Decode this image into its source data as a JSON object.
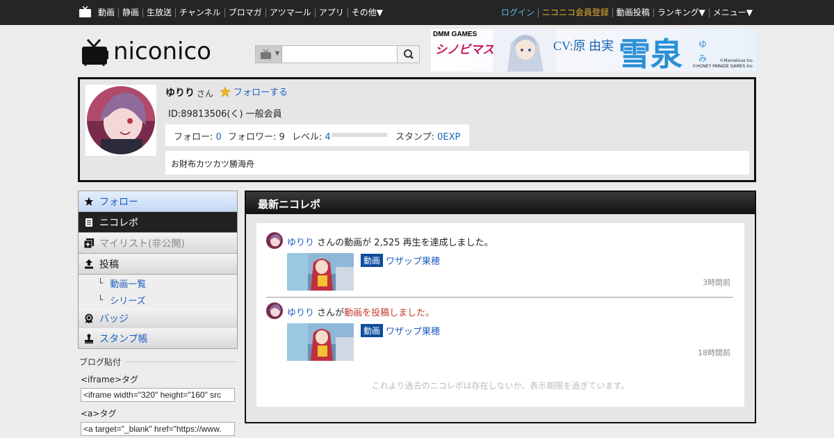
{
  "topbar": {
    "left_items": [
      "動画",
      "静画",
      "生放送",
      "チャンネル",
      "ブロマガ",
      "アツマール",
      "アプリ",
      "その他▼"
    ],
    "right_items": [
      {
        "label": "ログイン",
        "kind": "login"
      },
      {
        "label": "ニコニコ会員登録",
        "kind": "premium"
      },
      {
        "label": "動画投稿",
        "kind": "normal"
      },
      {
        "label": "ランキング▼",
        "kind": "normal"
      },
      {
        "label": "メニュー▼",
        "kind": "normal"
      }
    ]
  },
  "header": {
    "logo_text": "niconico",
    "search": {
      "value": "",
      "placeholder": ""
    }
  },
  "banner": {
    "brand": "DMM GAMES",
    "game": "シノビマスター",
    "cv": "CV:原 由実",
    "name": "雪泉",
    "reading": "ゆみ",
    "copyright1": "©Marvelous Inc.",
    "copyright2": "©HONEY PARADE GAMES Inc."
  },
  "profile": {
    "name": "ゆりり",
    "suffix": "さん",
    "follow_label": "フォローする",
    "id_line": "ID:89813506(く) 一般会員",
    "stats": {
      "follow_label": "フォロー:",
      "follow_value": "0",
      "follower_label": "フォロワー:",
      "follower_value": "9",
      "level_label": "レベル:",
      "level_value": "4",
      "level_progress": 0,
      "stamp_label": "スタンプ:",
      "stamp_value": "0EXP"
    },
    "description": "お財布カツカツ勝海舟"
  },
  "sidebar": {
    "items": [
      {
        "label": "フォロー",
        "icon": "star-icon"
      },
      {
        "label": "ニコレポ",
        "icon": "document-icon"
      },
      {
        "label": "マイリスト(非公開)",
        "icon": "mylist-add-icon"
      },
      {
        "label": "投稿",
        "icon": "upload-icon"
      },
      {
        "label": "動画一覧"
      },
      {
        "label": "シリーズ"
      },
      {
        "label": "バッジ",
        "icon": "badge-icon"
      },
      {
        "label": "スタンプ帳",
        "icon": "stamp-icon"
      }
    ],
    "sub_marker": "└"
  },
  "blog": {
    "heading": "ブログ貼付",
    "iframe_label": "<iframe>タグ",
    "iframe_value": "<iframe width=\"320\" height=\"160\" src",
    "a_label": "<a>タグ",
    "a_value": "<a target=\"_blank\" href=\"https://www."
  },
  "main": {
    "title": "最新ニコレポ",
    "entries": [
      {
        "user": "ゆりり",
        "text_before": "さんの動画が 2,525 再生を達成しました。",
        "action": "",
        "tag": "動画",
        "video_title": "ワザップ果穂",
        "time": "3時間前"
      },
      {
        "user": "ゆりり",
        "text_before": "さんが",
        "action": "動画を投稿しました。",
        "tag": "動画",
        "video_title": "ワザップ果穂",
        "time": "18時間前"
      }
    ],
    "end_note": "これより過去のニコレポは存在しないか、表示期限を過ぎています。"
  }
}
